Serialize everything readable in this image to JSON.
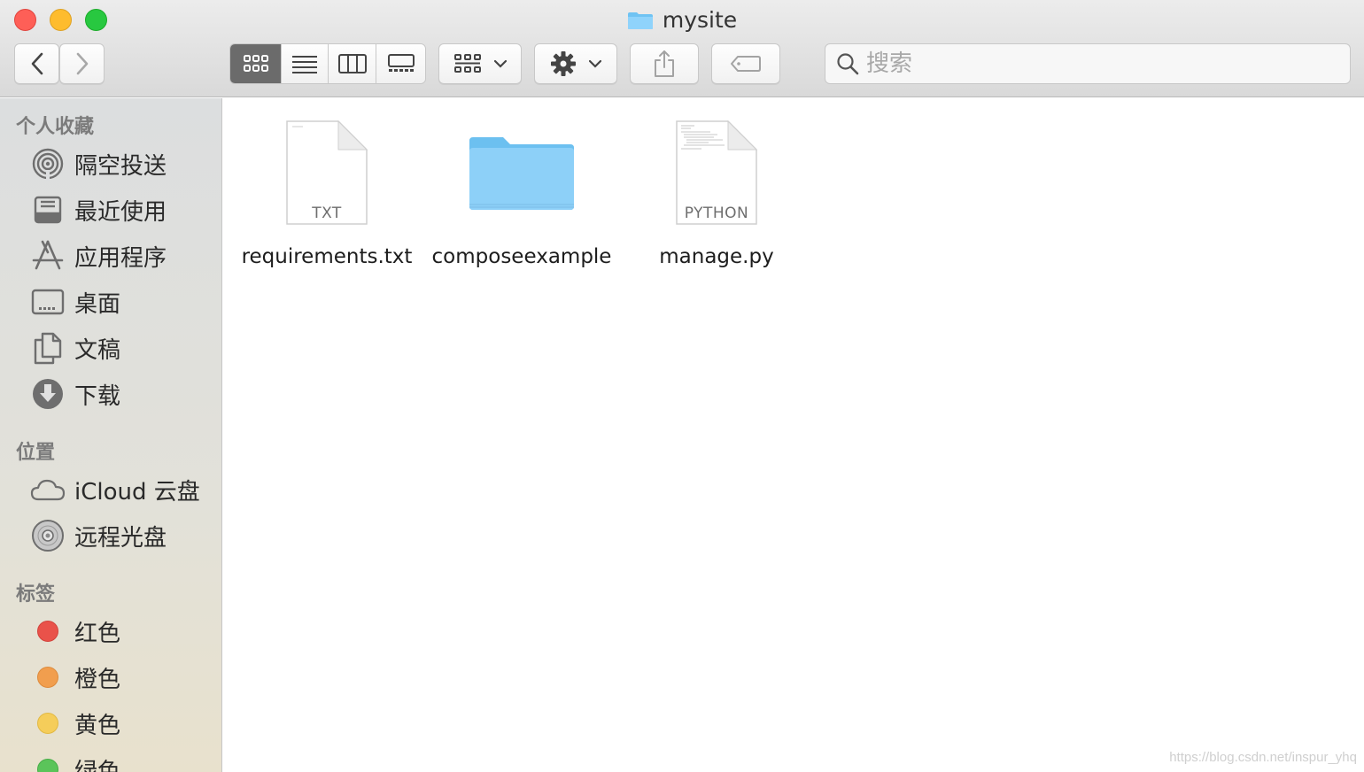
{
  "window": {
    "title": "mysite"
  },
  "toolbar": {
    "search_placeholder": "搜索",
    "view_modes": [
      "icon-view-icon",
      "list-view-icon",
      "column-view-icon",
      "gallery-view-icon"
    ],
    "active_view": "icon-view-icon"
  },
  "sidebar": {
    "favorites": {
      "heading": "个人收藏",
      "items": [
        {
          "label": "隔空投送",
          "icon": "airdrop-icon"
        },
        {
          "label": "最近使用",
          "icon": "recents-icon"
        },
        {
          "label": "应用程序",
          "icon": "applications-icon"
        },
        {
          "label": "桌面",
          "icon": "desktop-icon"
        },
        {
          "label": "文稿",
          "icon": "documents-icon"
        },
        {
          "label": "下载",
          "icon": "downloads-icon"
        }
      ]
    },
    "locations": {
      "heading": "位置",
      "items": [
        {
          "label": "iCloud 云盘",
          "icon": "icloud-icon"
        },
        {
          "label": "远程光盘",
          "icon": "remote-disc-icon"
        }
      ]
    },
    "tags": {
      "heading": "标签",
      "items": [
        {
          "label": "红色",
          "color": "#e9524a"
        },
        {
          "label": "橙色",
          "color": "#f19e4e"
        },
        {
          "label": "黄色",
          "color": "#f5cd5a"
        },
        {
          "label": "绿色",
          "color": "#5bc45a"
        }
      ]
    }
  },
  "files": [
    {
      "name": "requirements.txt",
      "type": "document",
      "ext": "TXT"
    },
    {
      "name": "composeexample",
      "type": "folder"
    },
    {
      "name": "manage.py",
      "type": "document",
      "ext": "PYTHON"
    }
  ],
  "watermark": "https://blog.csdn.net/inspur_yhq"
}
